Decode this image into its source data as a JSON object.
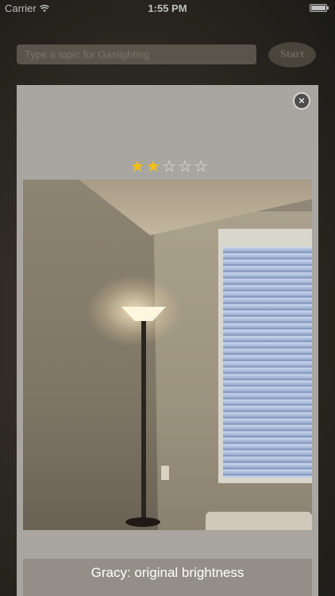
{
  "status_bar": {
    "carrier": "Carrier",
    "time": "1:55 PM"
  },
  "background_app": {
    "search_placeholder": "Type a topic for Gaslighting",
    "start_label": "Start"
  },
  "modal": {
    "close_glyph": "×",
    "rating": {
      "value": 2,
      "max": 5,
      "filled_color": "#f4c10f"
    },
    "stars": [
      "★",
      "★",
      "☆",
      "☆",
      "☆"
    ],
    "caption": "Gracy: original brightness"
  }
}
